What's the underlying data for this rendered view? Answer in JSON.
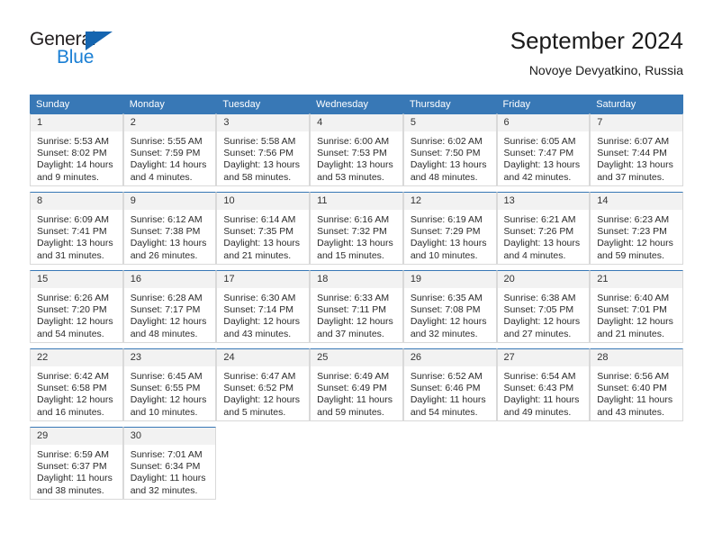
{
  "brand": {
    "name_top": "General",
    "name_bottom": "Blue",
    "accent_color": "#1a7fd4",
    "triangle_color": "#1565b0"
  },
  "header": {
    "title": "September 2024",
    "subtitle": "Novoye Devyatkino, Russia"
  },
  "theme": {
    "header_bar_color": "#3878b6",
    "daynum_bg": "#f2f2f2",
    "cell_border": "#d9d9d9"
  },
  "weekday_headers": [
    "Sunday",
    "Monday",
    "Tuesday",
    "Wednesday",
    "Thursday",
    "Friday",
    "Saturday"
  ],
  "weeks": [
    [
      {
        "day": "1",
        "sunrise": "Sunrise: 5:53 AM",
        "sunset": "Sunset: 8:02 PM",
        "daylight_1": "Daylight: 14 hours",
        "daylight_2": "and 9 minutes."
      },
      {
        "day": "2",
        "sunrise": "Sunrise: 5:55 AM",
        "sunset": "Sunset: 7:59 PM",
        "daylight_1": "Daylight: 14 hours",
        "daylight_2": "and 4 minutes."
      },
      {
        "day": "3",
        "sunrise": "Sunrise: 5:58 AM",
        "sunset": "Sunset: 7:56 PM",
        "daylight_1": "Daylight: 13 hours",
        "daylight_2": "and 58 minutes."
      },
      {
        "day": "4",
        "sunrise": "Sunrise: 6:00 AM",
        "sunset": "Sunset: 7:53 PM",
        "daylight_1": "Daylight: 13 hours",
        "daylight_2": "and 53 minutes."
      },
      {
        "day": "5",
        "sunrise": "Sunrise: 6:02 AM",
        "sunset": "Sunset: 7:50 PM",
        "daylight_1": "Daylight: 13 hours",
        "daylight_2": "and 48 minutes."
      },
      {
        "day": "6",
        "sunrise": "Sunrise: 6:05 AM",
        "sunset": "Sunset: 7:47 PM",
        "daylight_1": "Daylight: 13 hours",
        "daylight_2": "and 42 minutes."
      },
      {
        "day": "7",
        "sunrise": "Sunrise: 6:07 AM",
        "sunset": "Sunset: 7:44 PM",
        "daylight_1": "Daylight: 13 hours",
        "daylight_2": "and 37 minutes."
      }
    ],
    [
      {
        "day": "8",
        "sunrise": "Sunrise: 6:09 AM",
        "sunset": "Sunset: 7:41 PM",
        "daylight_1": "Daylight: 13 hours",
        "daylight_2": "and 31 minutes."
      },
      {
        "day": "9",
        "sunrise": "Sunrise: 6:12 AM",
        "sunset": "Sunset: 7:38 PM",
        "daylight_1": "Daylight: 13 hours",
        "daylight_2": "and 26 minutes."
      },
      {
        "day": "10",
        "sunrise": "Sunrise: 6:14 AM",
        "sunset": "Sunset: 7:35 PM",
        "daylight_1": "Daylight: 13 hours",
        "daylight_2": "and 21 minutes."
      },
      {
        "day": "11",
        "sunrise": "Sunrise: 6:16 AM",
        "sunset": "Sunset: 7:32 PM",
        "daylight_1": "Daylight: 13 hours",
        "daylight_2": "and 15 minutes."
      },
      {
        "day": "12",
        "sunrise": "Sunrise: 6:19 AM",
        "sunset": "Sunset: 7:29 PM",
        "daylight_1": "Daylight: 13 hours",
        "daylight_2": "and 10 minutes."
      },
      {
        "day": "13",
        "sunrise": "Sunrise: 6:21 AM",
        "sunset": "Sunset: 7:26 PM",
        "daylight_1": "Daylight: 13 hours",
        "daylight_2": "and 4 minutes."
      },
      {
        "day": "14",
        "sunrise": "Sunrise: 6:23 AM",
        "sunset": "Sunset: 7:23 PM",
        "daylight_1": "Daylight: 12 hours",
        "daylight_2": "and 59 minutes."
      }
    ],
    [
      {
        "day": "15",
        "sunrise": "Sunrise: 6:26 AM",
        "sunset": "Sunset: 7:20 PM",
        "daylight_1": "Daylight: 12 hours",
        "daylight_2": "and 54 minutes."
      },
      {
        "day": "16",
        "sunrise": "Sunrise: 6:28 AM",
        "sunset": "Sunset: 7:17 PM",
        "daylight_1": "Daylight: 12 hours",
        "daylight_2": "and 48 minutes."
      },
      {
        "day": "17",
        "sunrise": "Sunrise: 6:30 AM",
        "sunset": "Sunset: 7:14 PM",
        "daylight_1": "Daylight: 12 hours",
        "daylight_2": "and 43 minutes."
      },
      {
        "day": "18",
        "sunrise": "Sunrise: 6:33 AM",
        "sunset": "Sunset: 7:11 PM",
        "daylight_1": "Daylight: 12 hours",
        "daylight_2": "and 37 minutes."
      },
      {
        "day": "19",
        "sunrise": "Sunrise: 6:35 AM",
        "sunset": "Sunset: 7:08 PM",
        "daylight_1": "Daylight: 12 hours",
        "daylight_2": "and 32 minutes."
      },
      {
        "day": "20",
        "sunrise": "Sunrise: 6:38 AM",
        "sunset": "Sunset: 7:05 PM",
        "daylight_1": "Daylight: 12 hours",
        "daylight_2": "and 27 minutes."
      },
      {
        "day": "21",
        "sunrise": "Sunrise: 6:40 AM",
        "sunset": "Sunset: 7:01 PM",
        "daylight_1": "Daylight: 12 hours",
        "daylight_2": "and 21 minutes."
      }
    ],
    [
      {
        "day": "22",
        "sunrise": "Sunrise: 6:42 AM",
        "sunset": "Sunset: 6:58 PM",
        "daylight_1": "Daylight: 12 hours",
        "daylight_2": "and 16 minutes."
      },
      {
        "day": "23",
        "sunrise": "Sunrise: 6:45 AM",
        "sunset": "Sunset: 6:55 PM",
        "daylight_1": "Daylight: 12 hours",
        "daylight_2": "and 10 minutes."
      },
      {
        "day": "24",
        "sunrise": "Sunrise: 6:47 AM",
        "sunset": "Sunset: 6:52 PM",
        "daylight_1": "Daylight: 12 hours",
        "daylight_2": "and 5 minutes."
      },
      {
        "day": "25",
        "sunrise": "Sunrise: 6:49 AM",
        "sunset": "Sunset: 6:49 PM",
        "daylight_1": "Daylight: 11 hours",
        "daylight_2": "and 59 minutes."
      },
      {
        "day": "26",
        "sunrise": "Sunrise: 6:52 AM",
        "sunset": "Sunset: 6:46 PM",
        "daylight_1": "Daylight: 11 hours",
        "daylight_2": "and 54 minutes."
      },
      {
        "day": "27",
        "sunrise": "Sunrise: 6:54 AM",
        "sunset": "Sunset: 6:43 PM",
        "daylight_1": "Daylight: 11 hours",
        "daylight_2": "and 49 minutes."
      },
      {
        "day": "28",
        "sunrise": "Sunrise: 6:56 AM",
        "sunset": "Sunset: 6:40 PM",
        "daylight_1": "Daylight: 11 hours",
        "daylight_2": "and 43 minutes."
      }
    ],
    [
      {
        "day": "29",
        "sunrise": "Sunrise: 6:59 AM",
        "sunset": "Sunset: 6:37 PM",
        "daylight_1": "Daylight: 11 hours",
        "daylight_2": "and 38 minutes."
      },
      {
        "day": "30",
        "sunrise": "Sunrise: 7:01 AM",
        "sunset": "Sunset: 6:34 PM",
        "daylight_1": "Daylight: 11 hours",
        "daylight_2": "and 32 minutes."
      },
      null,
      null,
      null,
      null,
      null
    ]
  ]
}
